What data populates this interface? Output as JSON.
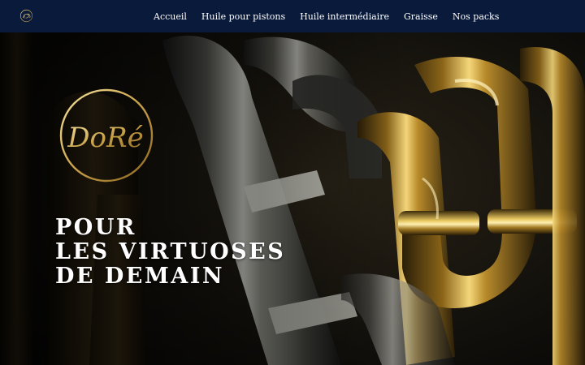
{
  "brand": {
    "logo_text": "DoRé"
  },
  "nav": {
    "items": [
      {
        "label": "Accueil"
      },
      {
        "label": "Huile pour pistons"
      },
      {
        "label": "Huile intermédiaire"
      },
      {
        "label": "Graisse"
      },
      {
        "label": "Nos packs"
      }
    ]
  },
  "hero": {
    "headline_lines": [
      "POUR",
      "LES VIRTUOSES",
      "DE DEMAIN"
    ],
    "background_icon": "brass-tuba-pipes-photo"
  },
  "colors": {
    "navbar_bg": "#0a1a3a",
    "text": "#ffffff",
    "gold": "#c9a24a"
  }
}
